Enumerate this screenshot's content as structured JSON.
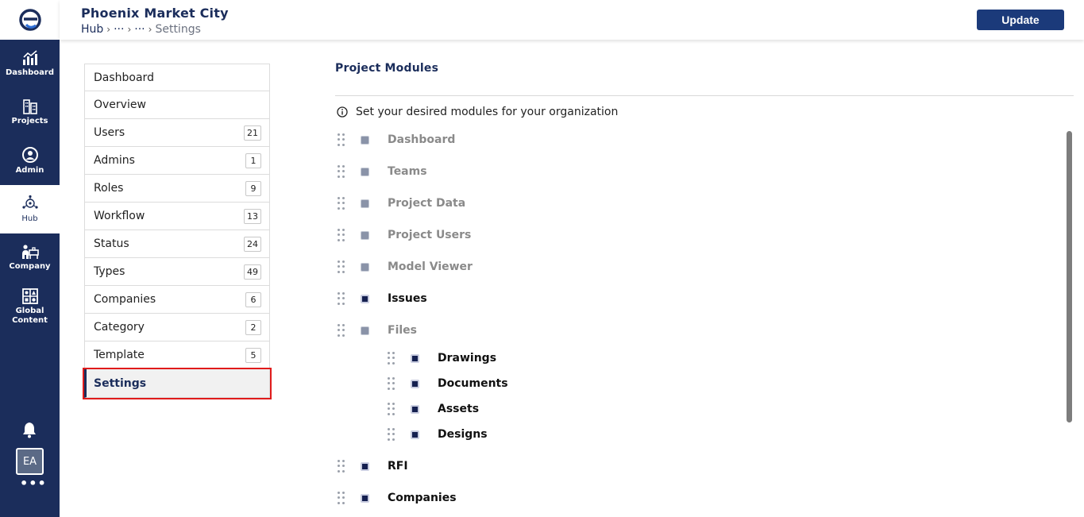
{
  "app": {
    "title": "Phoenix Market City",
    "breadcrumb": [
      "Hub",
      "···",
      "···",
      "Settings"
    ],
    "update_label": "Update"
  },
  "rail": {
    "items": [
      {
        "label": "Dashboard",
        "icon": "bar-chart-icon"
      },
      {
        "label": "Projects",
        "icon": "buildings-icon"
      },
      {
        "label": "Admin",
        "icon": "user-circle-icon"
      },
      {
        "label": "Hub",
        "icon": "hub-icon",
        "active": true
      },
      {
        "label": "Company",
        "icon": "company-icon"
      },
      {
        "label": "Global Content",
        "icon": "global-content-icon"
      }
    ],
    "avatar": "EA",
    "more": "•••"
  },
  "subnav": {
    "items": [
      {
        "label": "Dashboard",
        "count": ""
      },
      {
        "label": "Overview",
        "count": ""
      },
      {
        "label": "Users",
        "count": "21"
      },
      {
        "label": "Admins",
        "count": "1"
      },
      {
        "label": "Roles",
        "count": "9"
      },
      {
        "label": "Workflow",
        "count": "13"
      },
      {
        "label": "Status",
        "count": "24"
      },
      {
        "label": "Types",
        "count": "49"
      },
      {
        "label": "Companies",
        "count": "6"
      },
      {
        "label": "Category",
        "count": "2"
      },
      {
        "label": "Template",
        "count": "5"
      },
      {
        "label": "Settings",
        "count": "",
        "active": true
      }
    ]
  },
  "main": {
    "section_title": "Project Modules",
    "info_text": "Set your desired modules for your organization",
    "modules": [
      {
        "label": "Dashboard",
        "enabled": false
      },
      {
        "label": "Teams",
        "enabled": false
      },
      {
        "label": "Project Data",
        "enabled": false
      },
      {
        "label": "Project Users",
        "enabled": false
      },
      {
        "label": "Model Viewer",
        "enabled": false
      },
      {
        "label": "Issues",
        "enabled": true
      },
      {
        "label": "Files",
        "enabled": false
      },
      {
        "label": "Drawings",
        "enabled": true
      },
      {
        "label": "Documents",
        "enabled": true
      },
      {
        "label": "Assets",
        "enabled": true
      },
      {
        "label": "Designs",
        "enabled": true
      },
      {
        "label": "RFI",
        "enabled": true
      },
      {
        "label": "Companies",
        "enabled": true
      }
    ]
  },
  "colors": {
    "brand": "#1b2d5b",
    "button": "#1b3a7a",
    "highlight": "#e01b1b"
  }
}
